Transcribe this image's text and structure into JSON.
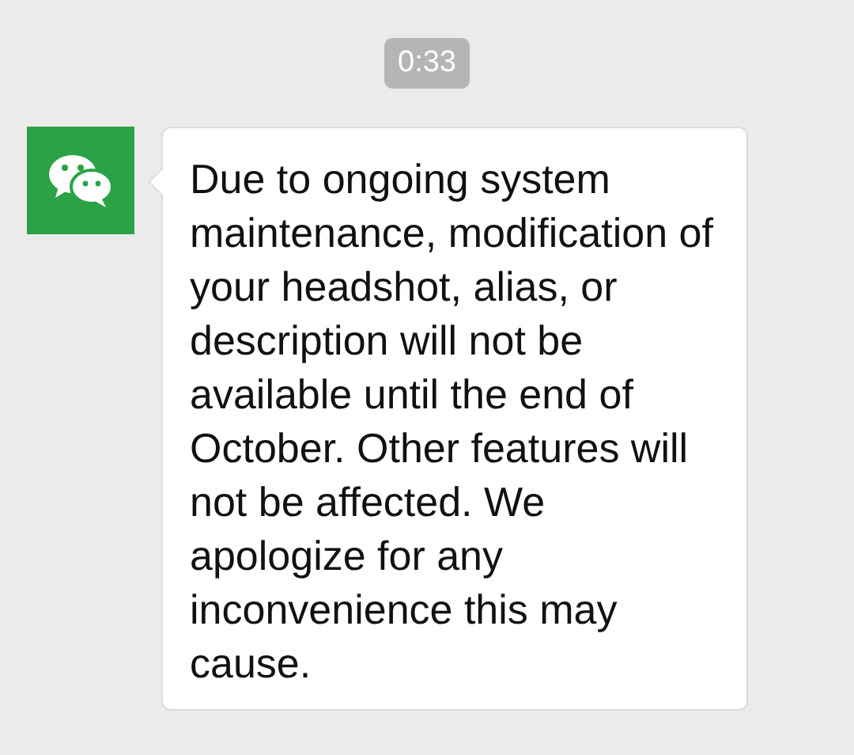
{
  "timestamp": "0:33",
  "messages": [
    {
      "text": "Due to ongoing system maintenance, modification of your headshot, alias, or description will not be available until the end of October. Other features will not be affected. We apologize for any inconvenience this may cause."
    }
  ]
}
